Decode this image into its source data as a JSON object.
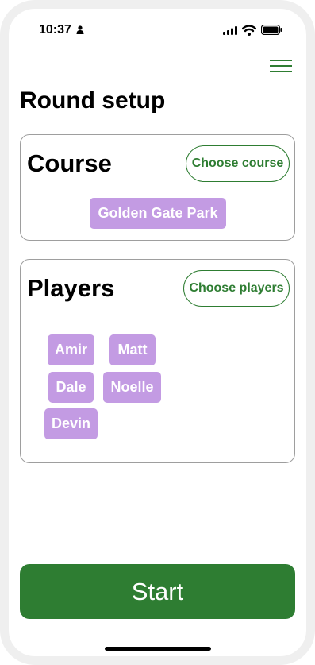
{
  "status_bar": {
    "time": "10:37"
  },
  "page": {
    "title": "Round setup"
  },
  "course": {
    "heading": "Course",
    "choose_label": "Choose course",
    "selected": "Golden Gate Park"
  },
  "players": {
    "heading": "Players",
    "choose_label": "Choose players",
    "items": [
      "Amir",
      "Matt",
      "Dale",
      "Noelle",
      "Devin"
    ]
  },
  "actions": {
    "start_label": "Start"
  },
  "colors": {
    "accent": "#2e7d32",
    "chip": "#c39be3",
    "card_border": "#9e9e9e"
  },
  "icons": [
    "person-icon",
    "signal-icon",
    "wifi-icon",
    "battery-icon",
    "menu-icon"
  ]
}
